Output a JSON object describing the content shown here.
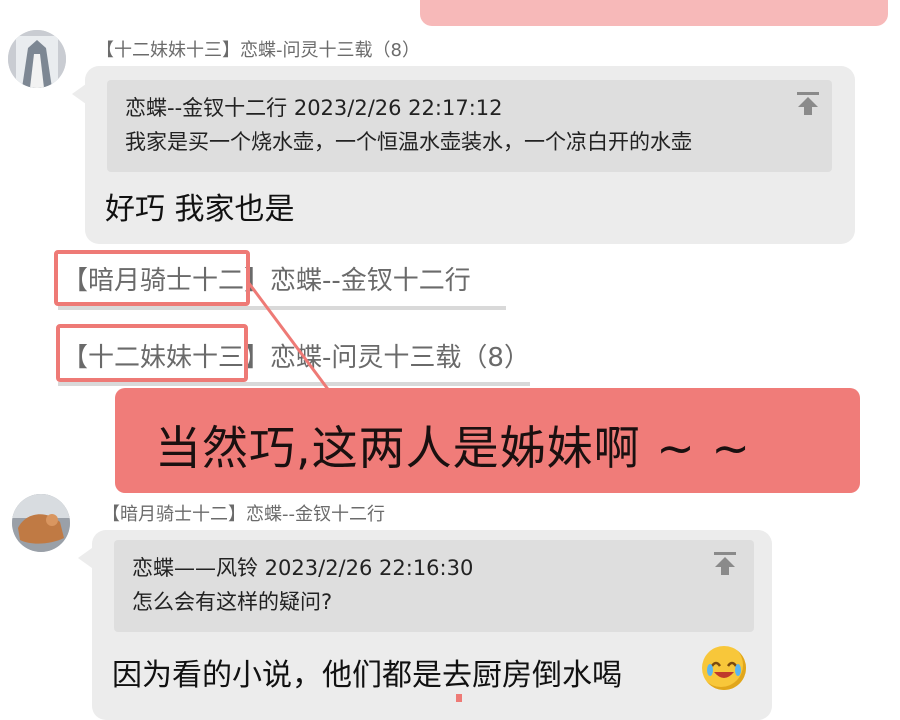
{
  "post1": {
    "sender": "【十二妹妹十三】恋蝶-问灵十三载（8）",
    "quote": {
      "meta": "恋蝶--金钗十二行  2023/2/26 22:17:12",
      "text": "我家是买一个烧水壶，一个恒温水壶装水，一个凉白开的水壶"
    },
    "message": "好巧 我家也是"
  },
  "thread": {
    "line1_tag": "【暗月骑士十二】",
    "line1_name": "恋蝶--金钗十二行",
    "line2_tag": "【十二妹妹十三】",
    "line2_name": "恋蝶-问灵十三载（8）"
  },
  "annotation": {
    "text": "当然巧,这两人是姊妹啊 ~ ~"
  },
  "post2": {
    "sender": "【暗月骑士十二】恋蝶--金钗十二行",
    "quote": {
      "meta": "恋蝶——风铃  2023/2/26 22:16:30",
      "text": "怎么会有这样的疑问?"
    },
    "message": "因为看的小说，他们都是去厨房倒水喝"
  },
  "colors": {
    "highlight": "#ee7a76",
    "annotation_bg": "#f07c79",
    "bubble_bg": "#ececec",
    "quote_bg": "#dedede"
  },
  "icons": [
    "pin-top-icon",
    "laughing-crying-emoji-icon"
  ]
}
